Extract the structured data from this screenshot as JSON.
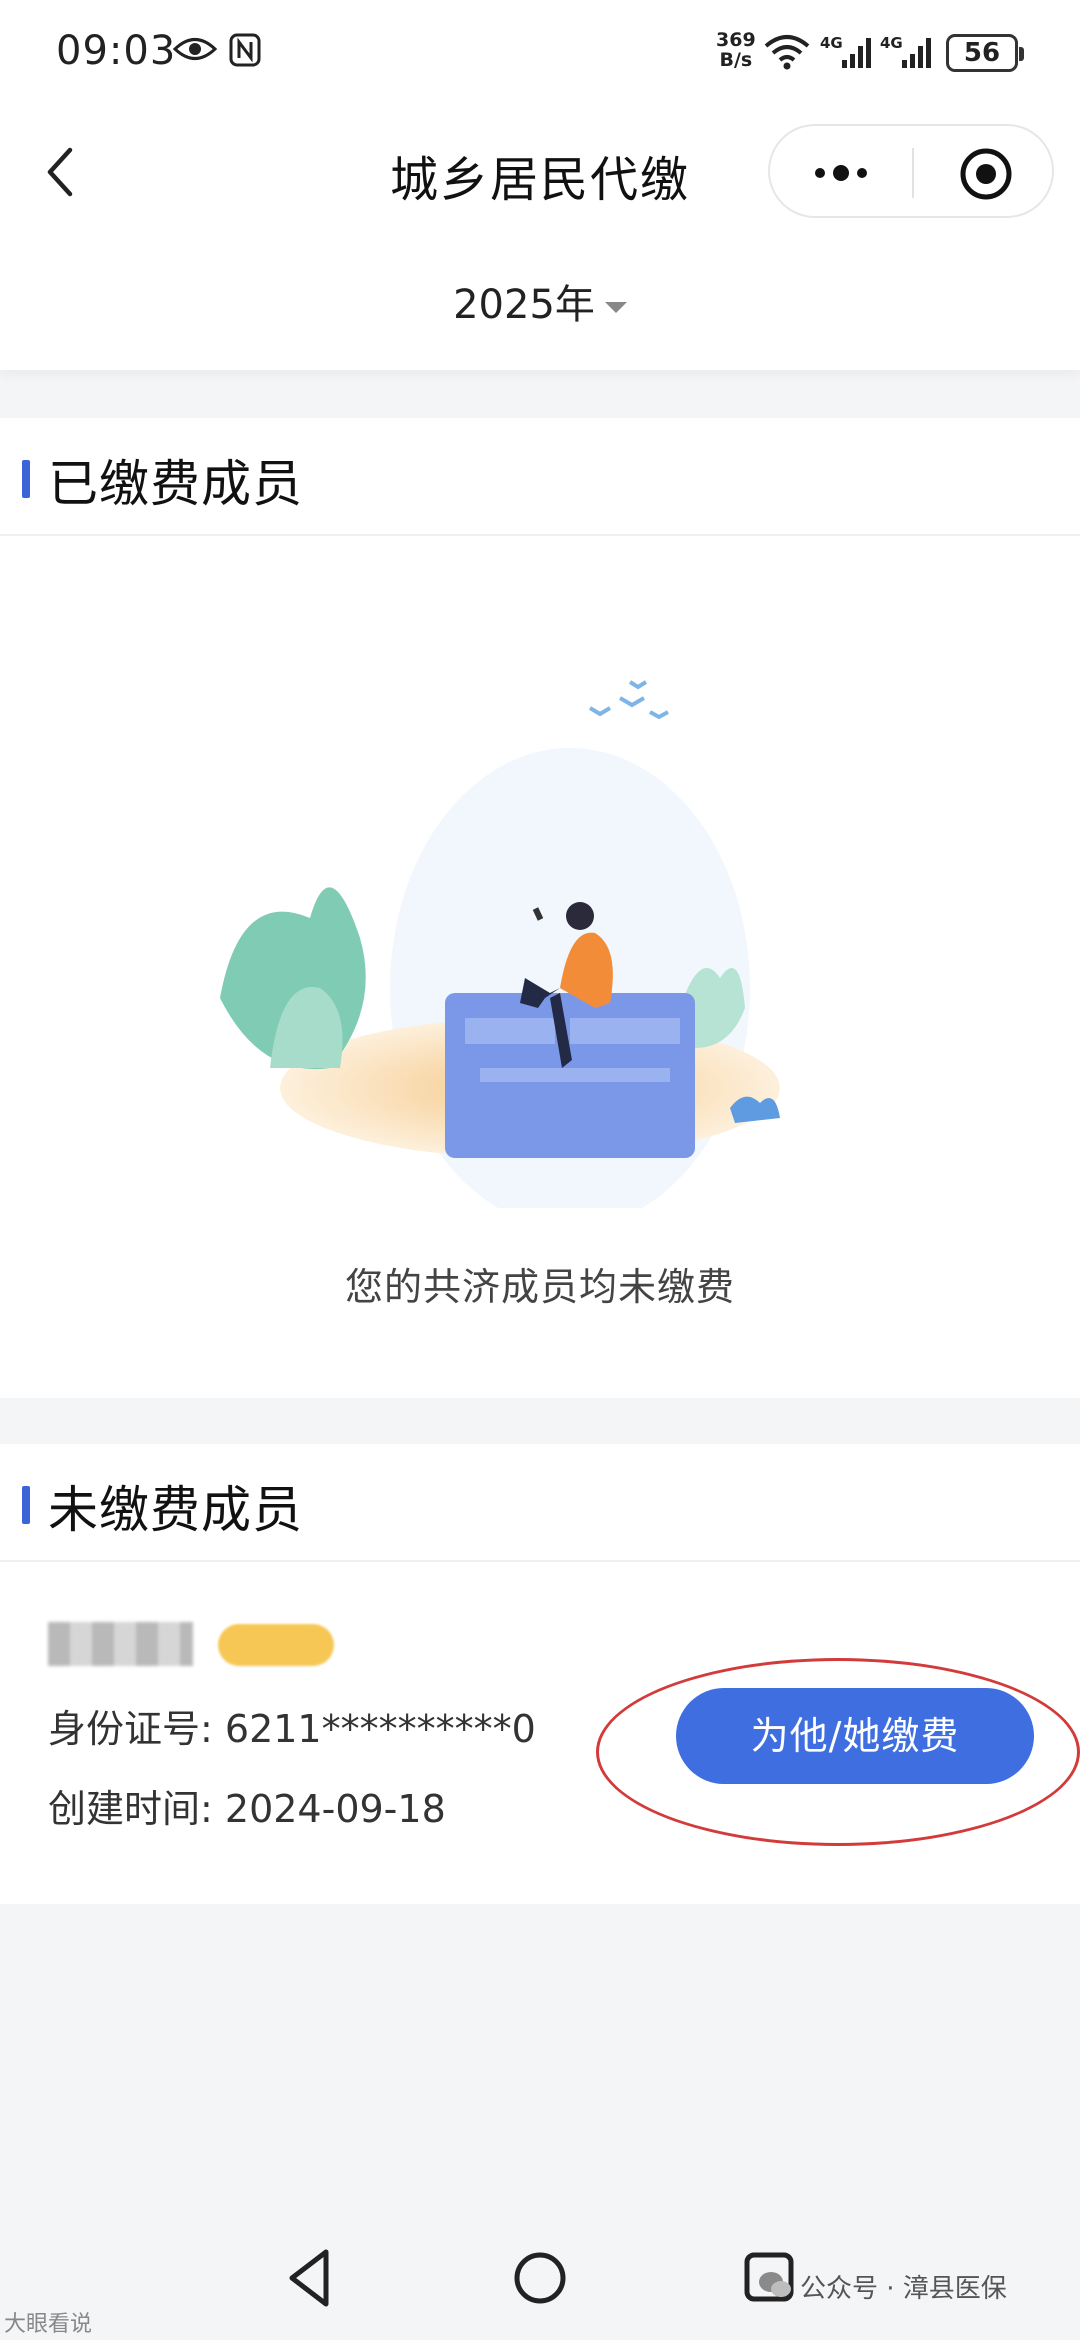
{
  "status_bar": {
    "time": "09:03",
    "net_speed_value": "369",
    "net_speed_unit": "B/s",
    "network_1": "4G",
    "network_2": "4G",
    "battery": "56"
  },
  "header": {
    "title": "城乡居民代缴",
    "back_icon": "chevron-left-icon",
    "more_icon": "more-dots-icon",
    "close_icon": "target-circle-icon"
  },
  "year_filter": {
    "selected": "2025年"
  },
  "paid_section": {
    "title": "已缴费成员",
    "empty_message": "您的共济成员均未缴费"
  },
  "unpaid_section": {
    "title": "未缴费成员",
    "members": [
      {
        "id_label": "身份证号:",
        "id_value": "6211**********0",
        "created_label": "创建时间:",
        "created_value": "2024-09-18",
        "pay_button": "为他/她缴费"
      }
    ]
  },
  "watermark": {
    "right": "公众号 · 漳县医保",
    "left": "大眼看说"
  },
  "colors": {
    "accent": "#3f6ee0",
    "section_bar": "#3b64d8",
    "annotation": "#d33a3a"
  }
}
